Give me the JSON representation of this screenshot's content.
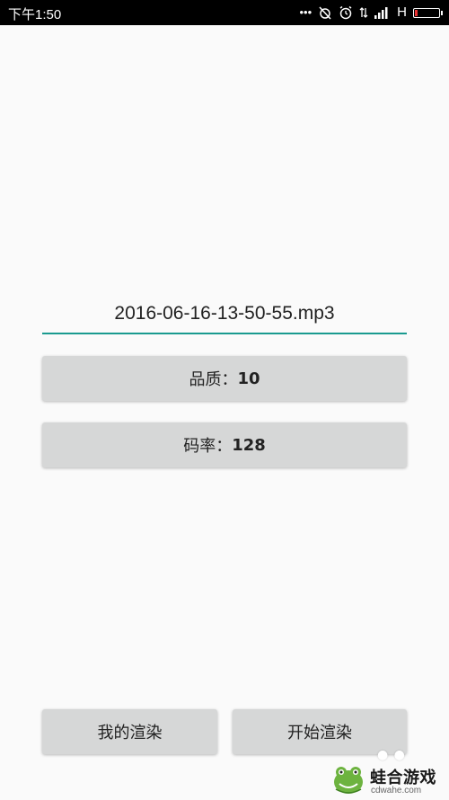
{
  "status_bar": {
    "time": "下午1:50",
    "icons": [
      "more-icon",
      "alarm-off-icon",
      "alarm-icon",
      "data-transfer-icon",
      "signal-icon",
      "battery-icon"
    ],
    "network_type": "H"
  },
  "form": {
    "filename": "2016-06-16-13-50-55.mp3",
    "quality_label": "品质：",
    "quality_value": "10",
    "bitrate_label": "码率：",
    "bitrate_value": "128"
  },
  "bottom": {
    "my_render_label": "我的渲染",
    "start_render_label": "开始渲染"
  },
  "watermark": {
    "brand": "蛙合游戏",
    "url": "cdwahe.com"
  },
  "colors": {
    "accent": "#1a9a8f",
    "button_bg": "#d6d7d7",
    "background": "#fafafa"
  }
}
